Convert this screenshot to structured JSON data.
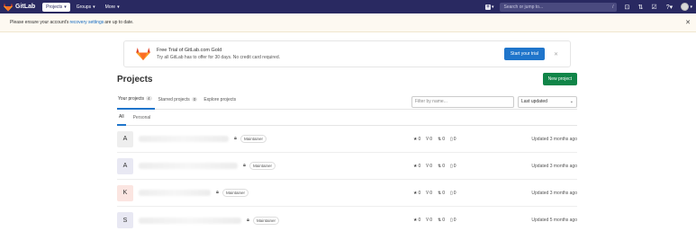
{
  "navbar": {
    "brand": "GitLab",
    "items": [
      {
        "label": "Projects",
        "active": true
      },
      {
        "label": "Groups",
        "active": false
      },
      {
        "label": "More",
        "active": false
      }
    ],
    "search_placeholder": "Search or jump to...",
    "search_shortcut": "/"
  },
  "alert": {
    "text_before": "Please ensure your account's ",
    "link": "recovery settings",
    "text_after": " are up to date."
  },
  "trial": {
    "title": "Free Trial of GitLab.com Gold",
    "subtitle": "Try all GitLab has to offer for 30 days. No credit card required.",
    "button": "Start your trial"
  },
  "page": {
    "title": "Projects",
    "new_button": "New project",
    "tabs": [
      {
        "label": "Your projects",
        "count": "4"
      },
      {
        "label": "Starred projects",
        "count": "0"
      },
      {
        "label": "Explore projects",
        "count": ""
      }
    ],
    "filter_placeholder": "Filter by name...",
    "sort_value": "Last updated",
    "subtabs": [
      "All",
      "Personal"
    ]
  },
  "projects": [
    {
      "letter": "A",
      "color": "#eeeeee",
      "role": "Maintainer",
      "stars": "0",
      "forks": "0",
      "mrs": "0",
      "issues": "0",
      "updated": "Updated 3 months ago"
    },
    {
      "letter": "A",
      "color": "#e8e8f3",
      "role": "Maintainer",
      "stars": "0",
      "forks": "0",
      "mrs": "0",
      "issues": "0",
      "updated": "Updated 3 months ago"
    },
    {
      "letter": "K",
      "color": "#fbe5e1",
      "role": "Maintainer",
      "stars": "0",
      "forks": "0",
      "mrs": "0",
      "issues": "0",
      "updated": "Updated 3 months ago"
    },
    {
      "letter": "S",
      "color": "#e8e8f3",
      "role": "Maintainer",
      "stars": "0",
      "forks": "0",
      "mrs": "0",
      "issues": "0",
      "updated": "Updated 5 months ago"
    }
  ]
}
